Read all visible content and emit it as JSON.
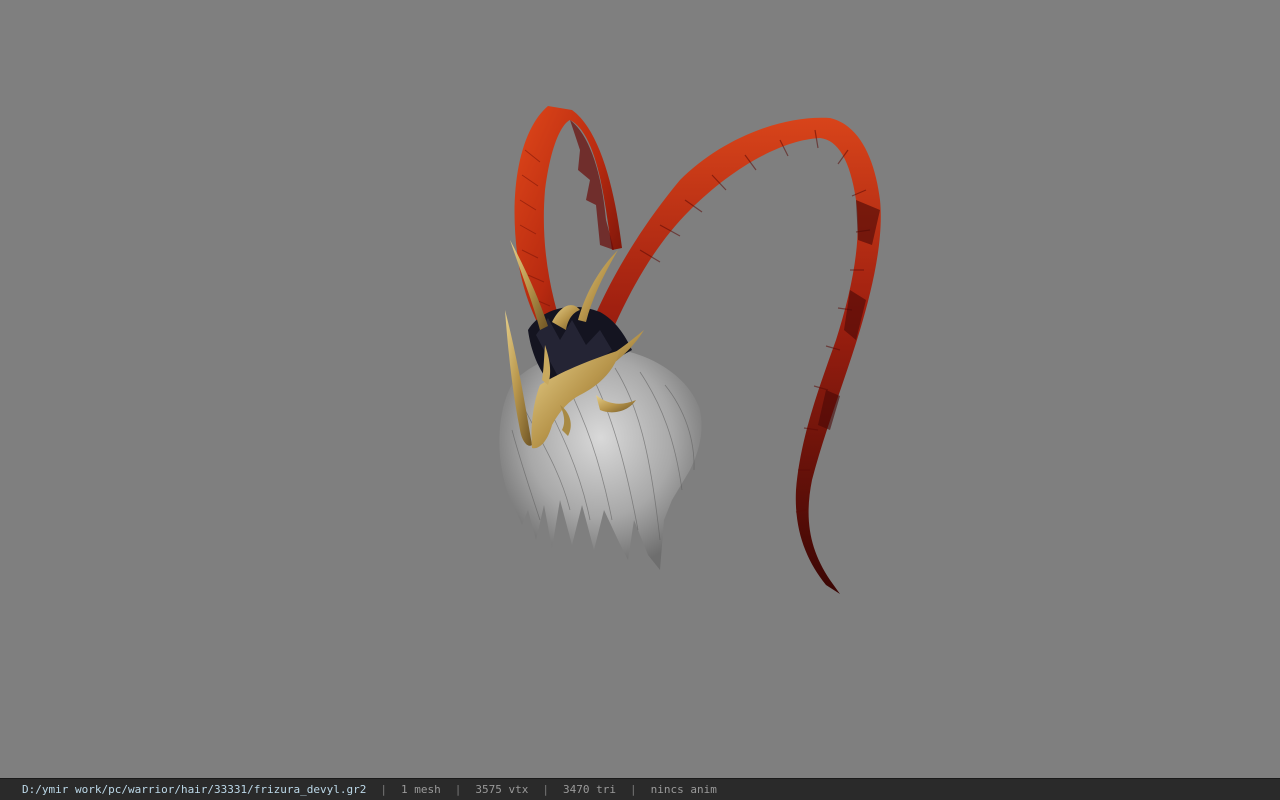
{
  "viewer": {
    "background_color": "#7f7f7f",
    "model": {
      "description_icon": "hair-model-icon"
    }
  },
  "status_bar": {
    "file_path": "D:/ymir work/pc/warrior/hair/33331/frizura_devyl.gr2",
    "separator": "|",
    "mesh_count": "1 mesh",
    "vertex_count": "3575 vtx",
    "triangle_count": "3470 tri",
    "animation": "nincs anim"
  }
}
